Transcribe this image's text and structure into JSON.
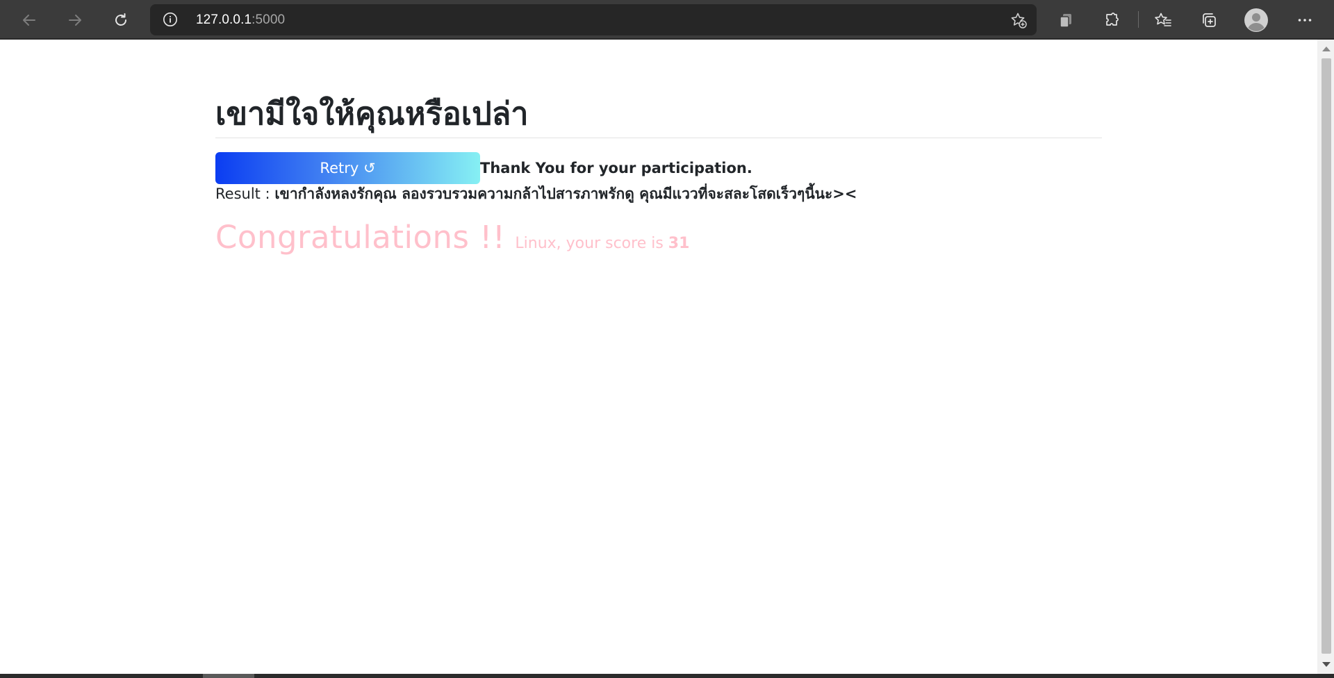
{
  "browser": {
    "url_host": "127.0.0.1",
    "url_port": ":5000",
    "icons": {
      "back": "arrow-left-icon",
      "forward": "arrow-right-icon",
      "refresh": "refresh-icon",
      "site_info": "info-icon",
      "add_favorite": "star-plus-icon",
      "copy": "copy-icon",
      "extensions": "puzzle-icon",
      "favorites": "favorites-icon",
      "collections": "collections-icon",
      "profile": "avatar-icon",
      "menu": "more-icon"
    }
  },
  "page": {
    "title": "เขามีใจให้คุณหรือเปล่า",
    "retry_label": "Retry ↺",
    "thanks": "Thank You for your participation.",
    "result_label": "Result : ",
    "result_value": "เขากำลังหลงรักคุณ ลองรวบรวมความกล้าไปสารภาพรักดู คุณมีแววที่จะสละโสดเร็วๆนี้นะ><",
    "congrats": "Congratulations !!",
    "score_prefix": "Linux, your score is ",
    "score_value": "31"
  },
  "colors": {
    "accent_pink": "#ffc0cb",
    "retry_gradient_start": "#0b3df2",
    "retry_gradient_end": "#86f0f3",
    "text_dark": "#212529",
    "chrome_bg": "#3b3b3b"
  }
}
